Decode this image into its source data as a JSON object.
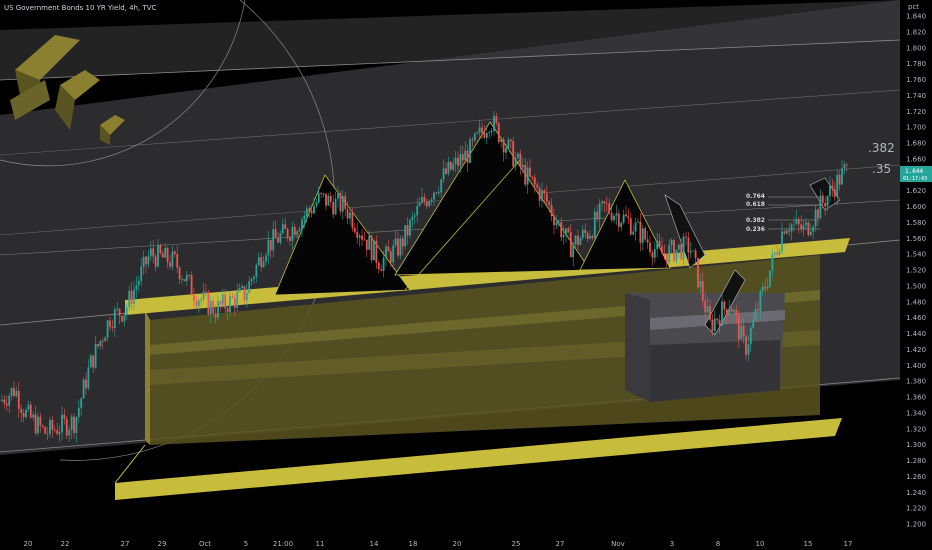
{
  "chart_title": "US Government Bonds 10 YR Yield, 4h, TVC",
  "chart_data": {
    "type": "candlestick",
    "title": "US Government Bonds 10 YR Yield, 4h, TVC",
    "y_unit": "pct",
    "ylim": [
      1.18,
      1.87
    ],
    "y_ticks": [
      "1.840",
      "1.820",
      "1.800",
      "1.780",
      "1.760",
      "1.740",
      "1.720",
      "1.700",
      "1.680",
      "1.660",
      "1.640",
      "1.620",
      "1.600",
      "1.580",
      "1.560",
      "1.540",
      "1.520",
      "1.500",
      "1.480",
      "1.460",
      "1.440",
      "1.420",
      "1.400",
      "1.380",
      "1.360",
      "1.340",
      "1.320",
      "1.300",
      "1.280",
      "1.260",
      "1.240",
      "1.220",
      "1.200"
    ],
    "x_ticks": [
      "20",
      "22",
      "27",
      "29",
      "Oct",
      "5",
      "21:00",
      "11",
      "14",
      "18",
      "20",
      "25",
      "27",
      "Nov",
      "3",
      "8",
      "10",
      "15",
      "17"
    ],
    "current_price": "1.644",
    "current_price_sub": "01:17:43",
    "fib_labels": [
      "0.764",
      "0.618",
      "0.382",
      "0.236"
    ],
    "big_fib_labels": [
      ".382",
      ".35"
    ],
    "colors": {
      "up": "#26a69a",
      "down": "#ef5350",
      "channel": "#c8bc3c",
      "price_badge": "#26a69a"
    }
  }
}
